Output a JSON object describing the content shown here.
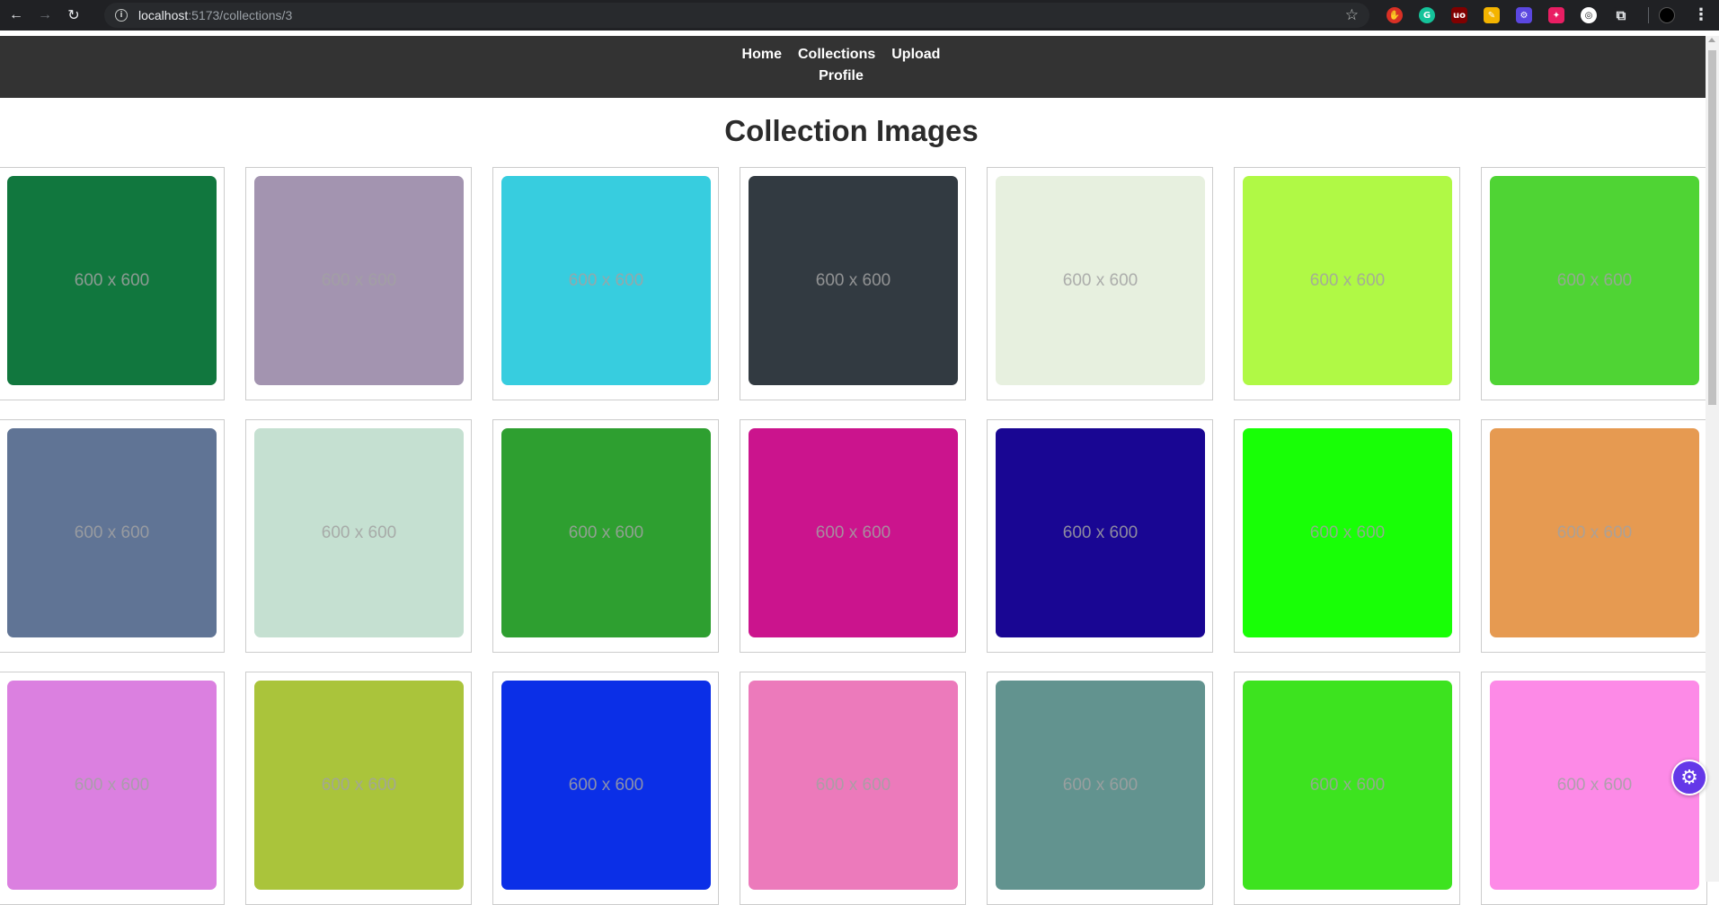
{
  "browser": {
    "url_host": "localhost",
    "url_rest": ":5173/collections/3",
    "extensions": [
      {
        "name": "hand-ext-icon",
        "color": "#d93025",
        "glyph": "✋",
        "round": true
      },
      {
        "name": "grammarly-ext-icon",
        "color": "#15c39a",
        "glyph": "G",
        "round": true
      },
      {
        "name": "ublock-ext-icon",
        "color": "#800000",
        "glyph": "uo",
        "round": false
      },
      {
        "name": "highlighter-ext-icon",
        "color": "#f4b400",
        "glyph": "✎",
        "round": false
      },
      {
        "name": "gear-ext-icon",
        "color": "#5b47e0",
        "glyph": "⚙",
        "round": false
      },
      {
        "name": "colorpick-ext-icon",
        "color": "#e91e63",
        "glyph": "✦",
        "round": false
      },
      {
        "name": "circle-ext-icon",
        "color": "#ffffff",
        "glyph": "◎",
        "round": true
      },
      {
        "name": "puzzle-extensions-icon",
        "color": "#202124",
        "glyph": "⧉",
        "round": false
      }
    ]
  },
  "nav": {
    "home": "Home",
    "collections": "Collections",
    "upload": "Upload",
    "profile": "Profile"
  },
  "page": {
    "title": "Collection Images"
  },
  "images": [
    {
      "label": "600 x 600",
      "color": "#11773e"
    },
    {
      "label": "600 x 600",
      "color": "#a394b0"
    },
    {
      "label": "600 x 600",
      "color": "#37cddf"
    },
    {
      "label": "600 x 600",
      "color": "#323a41"
    },
    {
      "label": "600 x 600",
      "color": "#e7f0df"
    },
    {
      "label": "600 x 600",
      "color": "#b0f945"
    },
    {
      "label": "600 x 600",
      "color": "#4fd434"
    },
    {
      "label": "600 x 600",
      "color": "#607495"
    },
    {
      "label": "600 x 600",
      "color": "#c5e0d1"
    },
    {
      "label": "600 x 600",
      "color": "#2e9f30"
    },
    {
      "label": "600 x 600",
      "color": "#cb148d"
    },
    {
      "label": "600 x 600",
      "color": "#190693"
    },
    {
      "label": "600 x 600",
      "color": "#18ff06"
    },
    {
      "label": "600 x 600",
      "color": "#e69a51"
    },
    {
      "label": "600 x 600",
      "color": "#db80e0"
    },
    {
      "label": "600 x 600",
      "color": "#aac43b"
    },
    {
      "label": "600 x 600",
      "color": "#0b2fe7"
    },
    {
      "label": "600 x 600",
      "color": "#ec7abb"
    },
    {
      "label": "600 x 600",
      "color": "#62938f"
    },
    {
      "label": "600 x 600",
      "color": "#3de31f"
    },
    {
      "label": "600 x 600",
      "color": "#fd8ae7"
    }
  ]
}
